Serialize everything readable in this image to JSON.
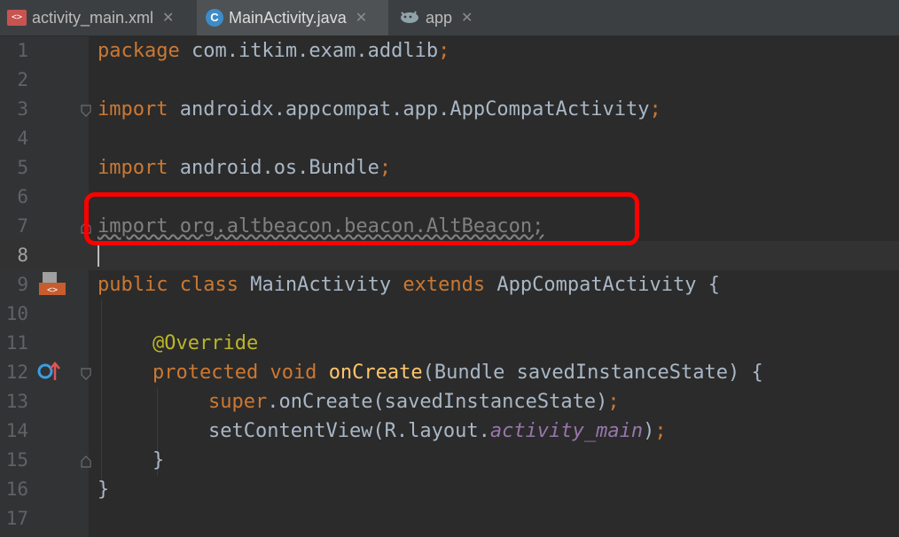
{
  "tabs": [
    {
      "label": "activity_main.xml",
      "icon": "xml-layout-icon",
      "icon_text": "<>"
    },
    {
      "label": "MainActivity.java",
      "icon": "java-class-icon",
      "icon_text": "C"
    },
    {
      "label": "app",
      "icon": "android-module-icon"
    }
  ],
  "close_glyph": "✕",
  "line_numbers": [
    "1",
    "2",
    "3",
    "4",
    "5",
    "6",
    "7",
    "8",
    "9",
    "10",
    "11",
    "12",
    "13",
    "14",
    "15",
    "16",
    "17"
  ],
  "code": {
    "l1_kw": "package",
    "l1_rest": " com.itkim.exam.addlib",
    "l3_kw": "import",
    "l3_rest": " androidx.appcompat.app.AppCompatActivity",
    "l5_kw": "import",
    "l5_rest": " android.os.Bundle",
    "l7_text": "import org.altbeacon.beacon.AltBeacon;",
    "l9_kw1": "public class",
    "l9_name": " MainActivity ",
    "l9_kw2": "extends",
    "l9_rest": " AppCompatActivity {",
    "l11_ann": "@Override",
    "l12_kw": "protected void",
    "l12_fn": "onCreate",
    "l12_rest": "(Bundle savedInstanceState) {",
    "l13_kw": "super",
    "l13_rest": ".onCreate(savedInstanceState)",
    "l14_rest": "setContentView(R.layout.",
    "l14_static": "activity_main",
    "l14_end": ")",
    "l15": "}",
    "l16": "}",
    "semicolon": ";"
  },
  "colors": {
    "keyword": "#cc7832",
    "annotation": "#bbb529",
    "method": "#ffc66d",
    "static_field": "#9876aa",
    "unused_import": "#808080",
    "highlight_box": "#ff0000"
  }
}
